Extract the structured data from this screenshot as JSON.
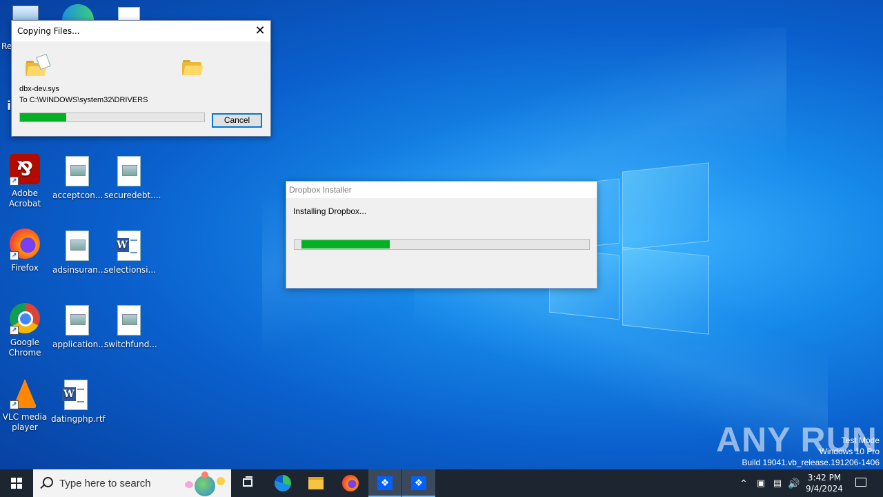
{
  "desktop": {
    "icons": [
      {
        "label": "Adobe Acrobat"
      },
      {
        "label": "acceptcon..."
      },
      {
        "label": "securedebt...."
      },
      {
        "label": "Firefox"
      },
      {
        "label": "adsinsuran..."
      },
      {
        "label": "selectionsi..."
      },
      {
        "label": "Google Chrome"
      },
      {
        "label": "application..."
      },
      {
        "label": "switchfund..."
      },
      {
        "label": "VLC media player"
      },
      {
        "label": "datingphp.rtf"
      }
    ],
    "partial_label_r": "Re",
    "partial_label_i": "i"
  },
  "copy_dialog": {
    "title": "Copying Files...",
    "filename": "dbx-dev.sys",
    "destination": "To C:\\WINDOWS\\system32\\DRIVERS",
    "progress_percent": 25,
    "cancel_label": "Cancel"
  },
  "dropbox_dialog": {
    "title": "Dropbox Installer",
    "status": "Installing Dropbox...",
    "progress_percent": 30
  },
  "watermark": {
    "brand": "ANY RUN",
    "line1": "Test Mode",
    "line2": "Windows 10 Pro",
    "line3": "Build 19041.vb_release.191206-1406"
  },
  "taskbar": {
    "search_placeholder": "Type here to search",
    "time": "3:42 PM",
    "date": "9/4/2024",
    "apps": [
      "task-view",
      "edge",
      "file-explorer",
      "firefox",
      "dropbox",
      "dropbox"
    ]
  },
  "colors": {
    "progress_green": "#06b025",
    "accent_blue": "#0078d7",
    "taskbar": "#1c2530"
  }
}
